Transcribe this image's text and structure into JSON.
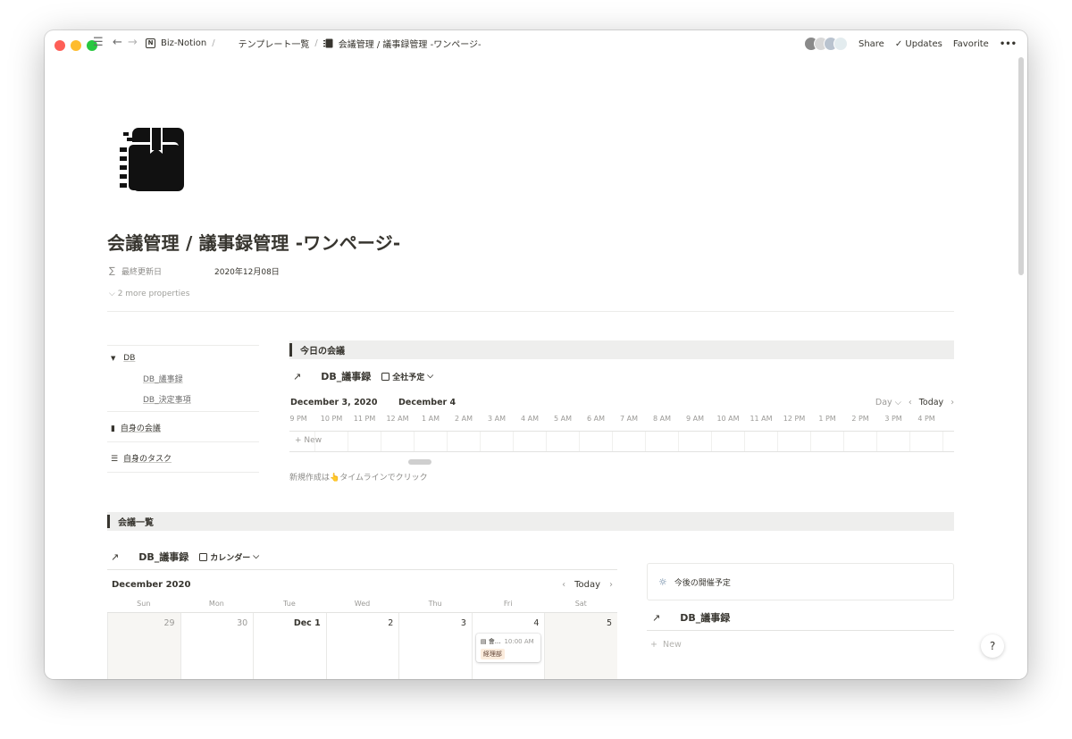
{
  "titlebar": {
    "workspace": "Biz-Notion",
    "breadcrumb_parent": "テンプレート一覧",
    "breadcrumb_current": "会議管理 / 議事録管理 -ワンページ-",
    "share": "Share",
    "updates": "Updates",
    "favorite": "Favorite",
    "more": "•••"
  },
  "page": {
    "title": "会議管理 / 議事録管理 -ワンページ-",
    "property_label": "最終更新日",
    "property_value": "2020年12月08日",
    "more_properties": "2 more properties"
  },
  "toc": {
    "db": "DB",
    "db_minutes": "DB_議事録",
    "db_decisions": "DB_決定事項",
    "my_meetings": "自身の会議",
    "my_tasks": "自身のタスク"
  },
  "today_section": {
    "heading": "今日の会議",
    "db_title": "DB_議事録",
    "view": "全社予定",
    "date_left": "December 3, 2020",
    "date_right": "December 4",
    "zoom": "Day",
    "today": "Today",
    "hours": [
      "9 PM",
      "10 PM",
      "11 PM",
      "12 AM",
      "1 AM",
      "2 AM",
      "3 AM",
      "4 AM",
      "5 AM",
      "6 AM",
      "7 AM",
      "8 AM",
      "9 AM",
      "10 AM",
      "11 AM",
      "12 PM",
      "1 PM",
      "2 PM",
      "3 PM",
      "4 PM"
    ],
    "new": "New",
    "hint": "新規作成は👆タイムラインでクリック"
  },
  "list_section": {
    "heading": "会議一覧",
    "db_title": "DB_議事録",
    "view": "カレンダー",
    "month": "December 2020",
    "today": "Today",
    "weekdays": [
      "Sun",
      "Mon",
      "Tue",
      "Wed",
      "Thu",
      "Fri",
      "Sat"
    ],
    "days": [
      "29",
      "30",
      "Dec 1",
      "2",
      "3",
      "4",
      "5"
    ],
    "event_title": "會...",
    "event_time": "10:00 AM",
    "event_tag": "経理部"
  },
  "side": {
    "callout": "今後の開催予定",
    "db_title": "DB_議事録",
    "new": "New"
  },
  "help": "?"
}
